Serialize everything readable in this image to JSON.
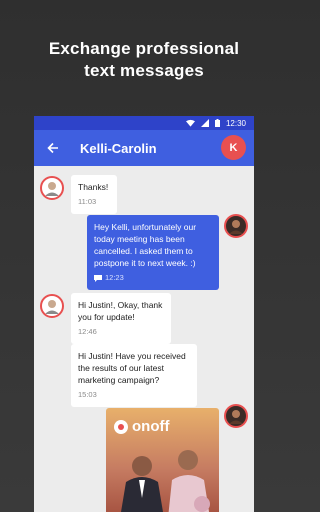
{
  "headline": {
    "line1": "Exchange professional",
    "line2": "text messages"
  },
  "status": {
    "time": "12:30"
  },
  "chat": {
    "contact_name": "Kelli-Carolin",
    "contact_initial": "K"
  },
  "messages": [
    {
      "text": "Thanks!",
      "time": "11:03"
    },
    {
      "text": "Hey Kelli, unfortunately our today meeting has been cancelled. I asked them to postpone it to next week. :)",
      "time": "12:23"
    },
    {
      "text": "Hi Justin!, Okay, thank you for update!",
      "time": "12:46"
    },
    {
      "text": "Hi Justin! Have you received the results of our latest marketing campaign?",
      "time": "15:03"
    }
  ],
  "media": {
    "brand": "onoff"
  },
  "colors": {
    "accent": "#3f5fe0",
    "status_bar": "#2e43c9",
    "avatar": "#e85050"
  }
}
